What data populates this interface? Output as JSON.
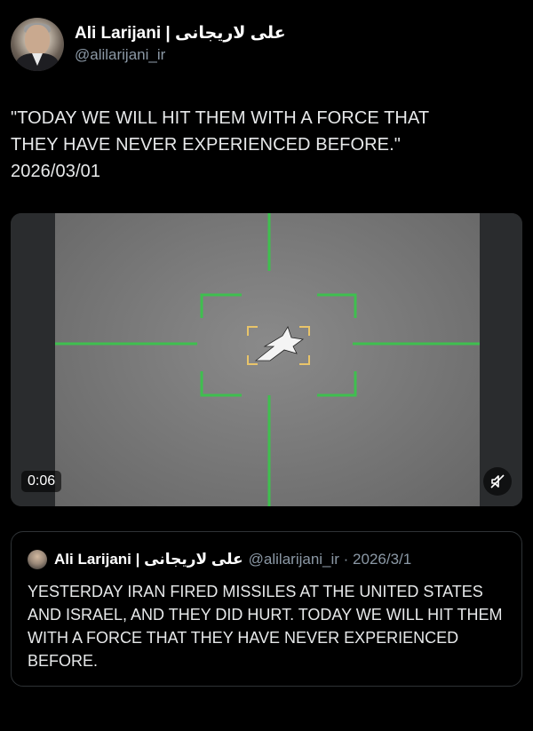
{
  "author": {
    "display_name": "Ali Larijani | علی لاریجانی",
    "handle": "@alilarijani_ir"
  },
  "tweet": {
    "lines": [
      "\"TODAY WE WILL HIT THEM WITH A FORCE THAT",
      "THEY HAVE NEVER EXPERIENCED BEFORE.\"",
      "2026/03/01"
    ]
  },
  "media": {
    "duration": "0:06",
    "mute_icon": "muted-speaker-icon",
    "reticle_color": "#3fbf4f",
    "target_box_color": "#e8c46a"
  },
  "quote": {
    "display_name": "Ali Larijani | علی لاریجانی",
    "meta": "@alilarijani_ir · 2026/3/1",
    "text": "YESTERDAY IRAN FIRED MISSILES AT THE UNITED STATES AND ISRAEL, AND THEY DID HURT. TODAY WE WILL HIT THEM WITH A FORCE THAT THEY HAVE NEVER EXPERIENCED BEFORE."
  },
  "colors": {
    "background": "#000000",
    "text": "#e7e9ea",
    "secondary": "#8b98a5",
    "border": "#2f3336"
  }
}
